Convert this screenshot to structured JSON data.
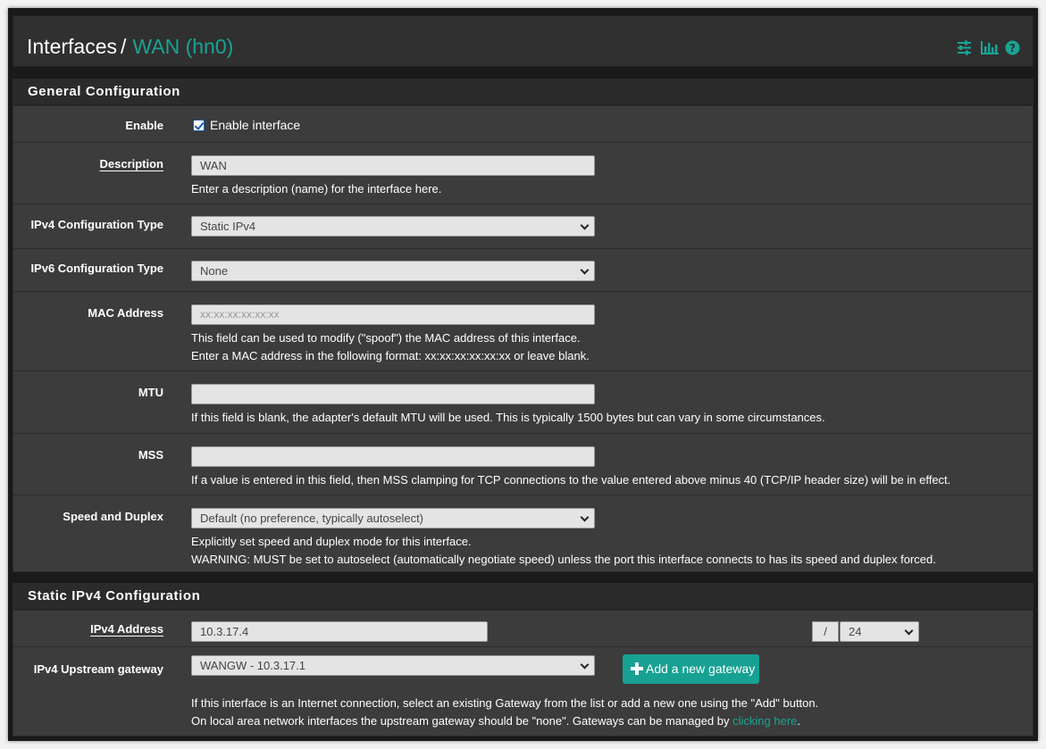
{
  "header": {
    "section": "Interfaces",
    "separator": "/",
    "current": "WAN (hn0)",
    "icons": [
      "sliders-icon",
      "bar-chart-icon",
      "help-icon"
    ]
  },
  "general": {
    "title": "General Configuration",
    "enable": {
      "label": "Enable",
      "checkbox_label": "Enable interface",
      "checked": true
    },
    "description": {
      "label": "Description",
      "value": "WAN",
      "help": "Enter a description (name) for the interface here."
    },
    "ipv4_type": {
      "label": "IPv4 Configuration Type",
      "value": "Static IPv4"
    },
    "ipv6_type": {
      "label": "IPv6 Configuration Type",
      "value": "None"
    },
    "mac": {
      "label": "MAC Address",
      "placeholder": "xx:xx:xx:xx:xx:xx",
      "help1": "This field can be used to modify (\"spoof\") the MAC address of this interface.",
      "help2": "Enter a MAC address in the following format: xx:xx:xx:xx:xx:xx or leave blank."
    },
    "mtu": {
      "label": "MTU",
      "value": "",
      "help": "If this field is blank, the adapter's default MTU will be used. This is typically 1500 bytes but can vary in some circumstances."
    },
    "mss": {
      "label": "MSS",
      "value": "",
      "help": "If a value is entered in this field, then MSS clamping for TCP connections to the value entered above minus 40 (TCP/IP header size) will be in effect."
    },
    "speed": {
      "label": "Speed and Duplex",
      "value": "Default (no preference, typically autoselect)",
      "help1": "Explicitly set speed and duplex mode for this interface.",
      "help2": "WARNING: MUST be set to autoselect (automatically negotiate speed) unless the port this interface connects to has its speed and duplex forced."
    }
  },
  "static": {
    "title": "Static IPv4 Configuration",
    "address": {
      "label": "IPv4 Address",
      "value": "10.3.17.4",
      "slash": "/",
      "cidr": "24"
    },
    "gateway": {
      "label": "IPv4 Upstream gateway",
      "value": "WANGW - 10.3.17.1",
      "add_button": "Add a new gateway",
      "help1": "If this interface is an Internet connection, select an existing Gateway from the list or add a new one using the \"Add\" button.",
      "help2_prefix": "On local area network interfaces the upstream gateway should be \"none\". Gateways can be managed by ",
      "help2_link": "clicking here",
      "help2_suffix": "."
    }
  },
  "colors": {
    "accent": "#1aa394",
    "panel": "#3c3c3c",
    "header": "#303030",
    "button": "#17a193"
  }
}
